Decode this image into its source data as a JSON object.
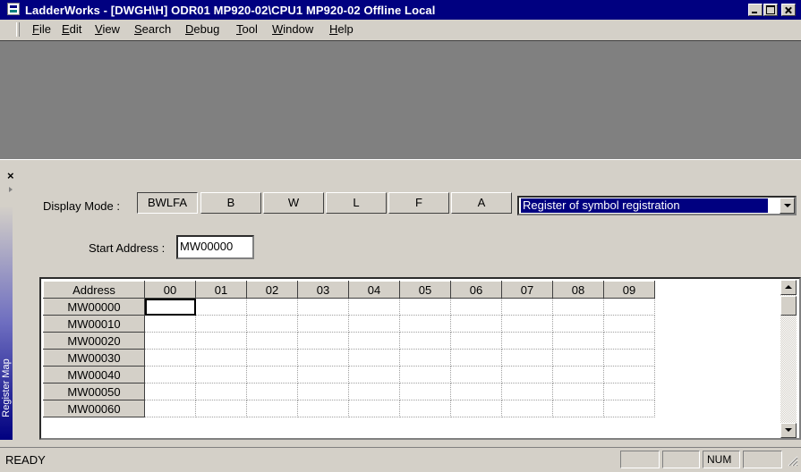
{
  "window": {
    "title": "LadderWorks - [DWGH\\H]    ODR01   MP920-02\\CPU1   MP920-02   Offline   Local"
  },
  "menu": [
    {
      "label": "File"
    },
    {
      "label": "Edit"
    },
    {
      "label": "View"
    },
    {
      "label": "Search"
    },
    {
      "label": "Debug"
    },
    {
      "label": "Tool"
    },
    {
      "label": "Window"
    },
    {
      "label": "Help"
    }
  ],
  "pane": {
    "close_glyph": "×",
    "sidebar_label": "Register Map"
  },
  "display_mode": {
    "label": "Display Mode :",
    "buttons": [
      "BWLFA",
      "B",
      "W",
      "L",
      "F",
      "A"
    ],
    "active": "BWLFA"
  },
  "register_select": {
    "value": "Register of symbol registration"
  },
  "start_address": {
    "label": "Start Address :",
    "value": "MW00000"
  },
  "grid": {
    "address_header": "Address",
    "columns": [
      "00",
      "01",
      "02",
      "03",
      "04",
      "05",
      "06",
      "07",
      "08",
      "09"
    ],
    "rows": [
      "MW00000",
      "MW00010",
      "MW00020",
      "MW00030",
      "MW00040",
      "MW00050",
      "MW00060"
    ],
    "selected_cell": "MW00000/00"
  },
  "statusbar": {
    "status": "READY",
    "num": "NUM"
  },
  "icons": [
    "app-icon",
    "minimize-icon",
    "maximize-icon",
    "close-icon",
    "chevron-down-icon",
    "scroll-up-icon",
    "scroll-down-icon",
    "size-grip-icon"
  ]
}
